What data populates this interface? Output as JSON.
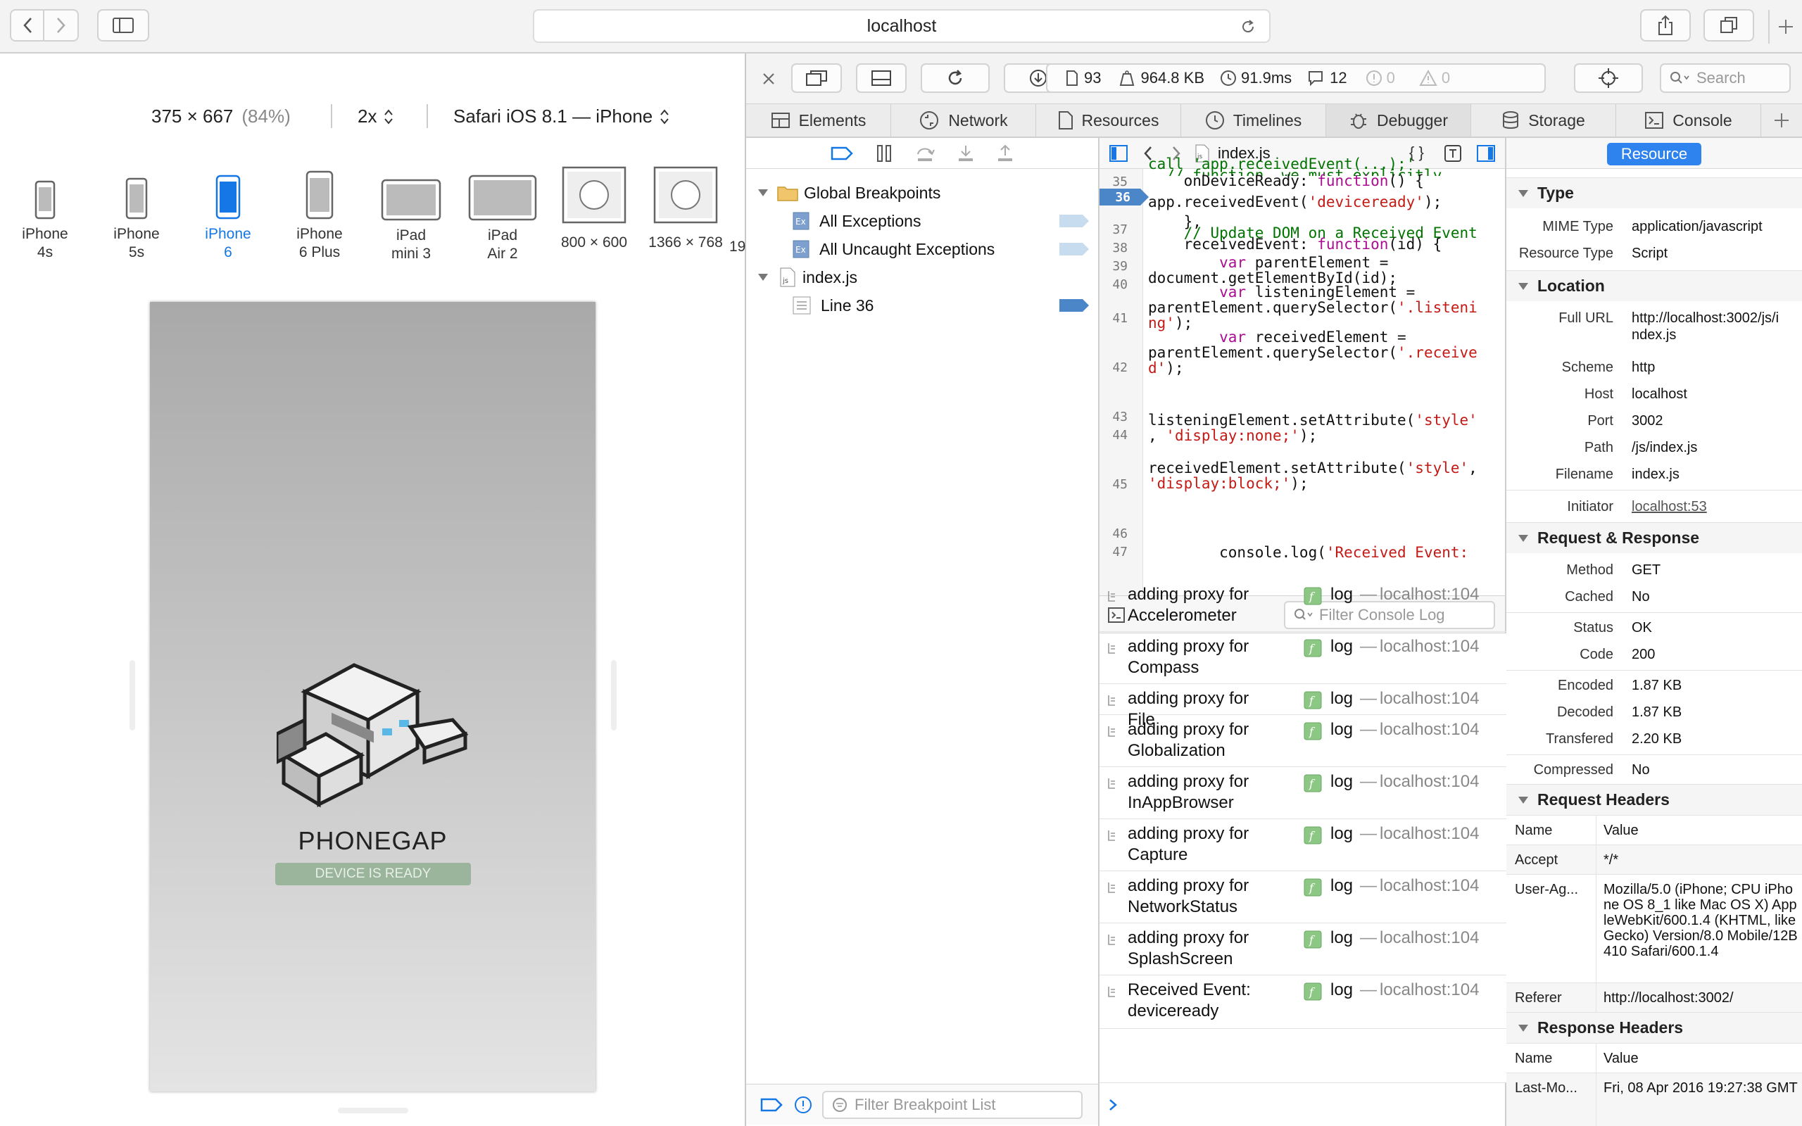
{
  "browser": {
    "url": "localhost"
  },
  "responsive": {
    "size": "375 × 667",
    "scale_pct": "(84%)",
    "pixel_ratio": "2x",
    "user_agent": "Safari iOS 8.1 — iPhone",
    "devices": [
      {
        "line1": "iPhone",
        "line2": "4s"
      },
      {
        "line1": "iPhone",
        "line2": "5s"
      },
      {
        "line1": "iPhone",
        "line2": "6"
      },
      {
        "line1": "iPhone",
        "line2": "6 Plus"
      },
      {
        "line1": "iPad",
        "line2": "mini 3"
      },
      {
        "line1": "iPad",
        "line2": "Air 2"
      },
      {
        "line1": "800 × 600",
        "line2": ""
      },
      {
        "line1": "1366 × 768",
        "line2": ""
      },
      {
        "line1": "19",
        "line2": ""
      }
    ],
    "app_title": "PHONEGAP",
    "app_status": "DEVICE IS READY"
  },
  "toolbar": {
    "resources_count": "93",
    "size": "964.8 KB",
    "time": "91.9ms",
    "logs": "12",
    "errors": "0",
    "warnings": "0",
    "search_placeholder": "Search"
  },
  "tabs": [
    "Elements",
    "Network",
    "Resources",
    "Timelines",
    "Debugger",
    "Storage",
    "Console"
  ],
  "breakpoints": {
    "global": "Global Breakpoints",
    "all_exceptions": "All Exceptions",
    "uncaught": "All Uncaught Exceptions",
    "file": "index.js",
    "line": "Line 36",
    "filter_placeholder": "Filter Breakpoint List"
  },
  "editor": {
    "filename": "index.js",
    "line_numbers": [
      "35",
      "36",
      "37",
      "38",
      "39",
      "40",
      "41",
      "42",
      "43",
      "44",
      "45",
      "46",
      "47"
    ],
    "active_line": "36"
  },
  "console": {
    "filter_placeholder": "Filter Console Log",
    "entries": [
      {
        "msg": "adding proxy for Accelerometer",
        "type": "log",
        "src": "localhost:104"
      },
      {
        "msg": "adding proxy for Compass",
        "type": "log",
        "src": "localhost:104"
      },
      {
        "msg": "adding proxy for File",
        "type": "log",
        "src": "localhost:104"
      },
      {
        "msg": "adding proxy for Globalization",
        "type": "log",
        "src": "localhost:104"
      },
      {
        "msg": "adding proxy for InAppBrowser",
        "type": "log",
        "src": "localhost:104"
      },
      {
        "msg": "adding proxy for Capture",
        "type": "log",
        "src": "localhost:104"
      },
      {
        "msg": "adding proxy for NetworkStatus",
        "type": "log",
        "src": "localhost:104"
      },
      {
        "msg": "adding proxy for SplashScreen",
        "type": "log",
        "src": "localhost:104"
      },
      {
        "msg": "Received Event: deviceready",
        "type": "log",
        "src": "localhost:104"
      }
    ],
    "separator": "—"
  },
  "details": {
    "resource_btn": "Resource",
    "type_section": "Type",
    "mime_label": "MIME Type",
    "mime": "application/javascript",
    "rtype_label": "Resource Type",
    "rtype": "Script",
    "location_section": "Location",
    "url_label": "Full URL",
    "url": "http://localhost:3002/js/index.js",
    "scheme_label": "Scheme",
    "scheme": "http",
    "host_label": "Host",
    "host": "localhost",
    "port_label": "Port",
    "port": "3002",
    "path_label": "Path",
    "path": "/js/index.js",
    "filename_label": "Filename",
    "filename": "index.js",
    "initiator_label": "Initiator",
    "initiator": "localhost:53",
    "rr_section": "Request & Response",
    "method_label": "Method",
    "method": "GET",
    "cached_label": "Cached",
    "cached": "No",
    "status_label": "Status",
    "status": "OK",
    "code_label": "Code",
    "code": "200",
    "encoded_label": "Encoded",
    "encoded": "1.87 KB",
    "decoded_label": "Decoded",
    "decoded": "1.87 KB",
    "transfered_label": "Transfered",
    "transfered": "2.20 KB",
    "compressed_label": "Compressed",
    "compressed": "No",
    "req_headers_section": "Request Headers",
    "name_col": "Name",
    "value_col": "Value",
    "accept_label": "Accept",
    "accept": "*/*",
    "ua_label": "User-Ag...",
    "ua": "Mozilla/5.0 (iPhone; CPU iPhone OS 8_1 like Mac OS X) AppleWebKit/600.1.4 (KHTML, like Gecko) Version/8.0 Mobile/12B410 Safari/600.1.4",
    "referer_label": "Referer",
    "referer": "http://localhost:3002/",
    "resp_headers_section": "Response Headers",
    "lastmod_label": "Last-Mo...",
    "lastmod": "Fri, 08 Apr 2016 19:27:38 GMT"
  }
}
